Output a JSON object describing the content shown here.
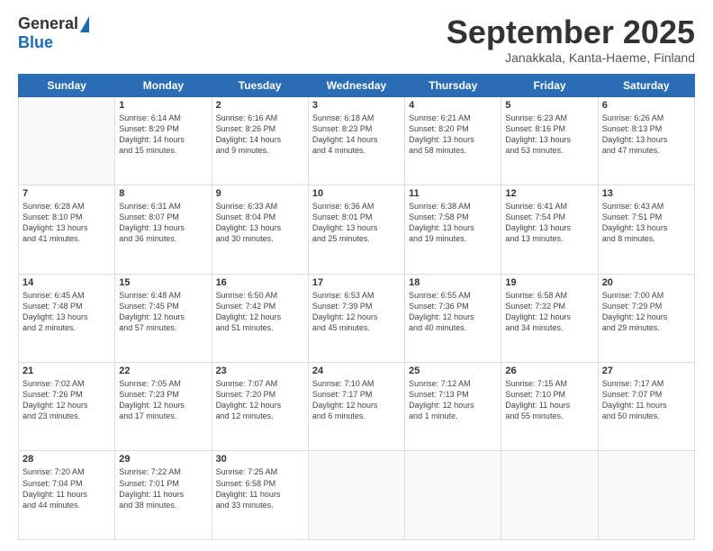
{
  "logo": {
    "general": "General",
    "blue": "Blue"
  },
  "header": {
    "month": "September 2025",
    "location": "Janakkala, Kanta-Haeme, Finland"
  },
  "days": [
    "Sunday",
    "Monday",
    "Tuesday",
    "Wednesday",
    "Thursday",
    "Friday",
    "Saturday"
  ],
  "weeks": [
    [
      {
        "day": "",
        "info": ""
      },
      {
        "day": "1",
        "info": "Sunrise: 6:14 AM\nSunset: 8:29 PM\nDaylight: 14 hours\nand 15 minutes."
      },
      {
        "day": "2",
        "info": "Sunrise: 6:16 AM\nSunset: 8:26 PM\nDaylight: 14 hours\nand 9 minutes."
      },
      {
        "day": "3",
        "info": "Sunrise: 6:18 AM\nSunset: 8:23 PM\nDaylight: 14 hours\nand 4 minutes."
      },
      {
        "day": "4",
        "info": "Sunrise: 6:21 AM\nSunset: 8:20 PM\nDaylight: 13 hours\nand 58 minutes."
      },
      {
        "day": "5",
        "info": "Sunrise: 6:23 AM\nSunset: 8:16 PM\nDaylight: 13 hours\nand 53 minutes."
      },
      {
        "day": "6",
        "info": "Sunrise: 6:26 AM\nSunset: 8:13 PM\nDaylight: 13 hours\nand 47 minutes."
      }
    ],
    [
      {
        "day": "7",
        "info": "Sunrise: 6:28 AM\nSunset: 8:10 PM\nDaylight: 13 hours\nand 41 minutes."
      },
      {
        "day": "8",
        "info": "Sunrise: 6:31 AM\nSunset: 8:07 PM\nDaylight: 13 hours\nand 36 minutes."
      },
      {
        "day": "9",
        "info": "Sunrise: 6:33 AM\nSunset: 8:04 PM\nDaylight: 13 hours\nand 30 minutes."
      },
      {
        "day": "10",
        "info": "Sunrise: 6:36 AM\nSunset: 8:01 PM\nDaylight: 13 hours\nand 25 minutes."
      },
      {
        "day": "11",
        "info": "Sunrise: 6:38 AM\nSunset: 7:58 PM\nDaylight: 13 hours\nand 19 minutes."
      },
      {
        "day": "12",
        "info": "Sunrise: 6:41 AM\nSunset: 7:54 PM\nDaylight: 13 hours\nand 13 minutes."
      },
      {
        "day": "13",
        "info": "Sunrise: 6:43 AM\nSunset: 7:51 PM\nDaylight: 13 hours\nand 8 minutes."
      }
    ],
    [
      {
        "day": "14",
        "info": "Sunrise: 6:45 AM\nSunset: 7:48 PM\nDaylight: 13 hours\nand 2 minutes."
      },
      {
        "day": "15",
        "info": "Sunrise: 6:48 AM\nSunset: 7:45 PM\nDaylight: 12 hours\nand 57 minutes."
      },
      {
        "day": "16",
        "info": "Sunrise: 6:50 AM\nSunset: 7:42 PM\nDaylight: 12 hours\nand 51 minutes."
      },
      {
        "day": "17",
        "info": "Sunrise: 6:53 AM\nSunset: 7:39 PM\nDaylight: 12 hours\nand 45 minutes."
      },
      {
        "day": "18",
        "info": "Sunrise: 6:55 AM\nSunset: 7:36 PM\nDaylight: 12 hours\nand 40 minutes."
      },
      {
        "day": "19",
        "info": "Sunrise: 6:58 AM\nSunset: 7:32 PM\nDaylight: 12 hours\nand 34 minutes."
      },
      {
        "day": "20",
        "info": "Sunrise: 7:00 AM\nSunset: 7:29 PM\nDaylight: 12 hours\nand 29 minutes."
      }
    ],
    [
      {
        "day": "21",
        "info": "Sunrise: 7:02 AM\nSunset: 7:26 PM\nDaylight: 12 hours\nand 23 minutes."
      },
      {
        "day": "22",
        "info": "Sunrise: 7:05 AM\nSunset: 7:23 PM\nDaylight: 12 hours\nand 17 minutes."
      },
      {
        "day": "23",
        "info": "Sunrise: 7:07 AM\nSunset: 7:20 PM\nDaylight: 12 hours\nand 12 minutes."
      },
      {
        "day": "24",
        "info": "Sunrise: 7:10 AM\nSunset: 7:17 PM\nDaylight: 12 hours\nand 6 minutes."
      },
      {
        "day": "25",
        "info": "Sunrise: 7:12 AM\nSunset: 7:13 PM\nDaylight: 12 hours\nand 1 minute."
      },
      {
        "day": "26",
        "info": "Sunrise: 7:15 AM\nSunset: 7:10 PM\nDaylight: 11 hours\nand 55 minutes."
      },
      {
        "day": "27",
        "info": "Sunrise: 7:17 AM\nSunset: 7:07 PM\nDaylight: 11 hours\nand 50 minutes."
      }
    ],
    [
      {
        "day": "28",
        "info": "Sunrise: 7:20 AM\nSunset: 7:04 PM\nDaylight: 11 hours\nand 44 minutes."
      },
      {
        "day": "29",
        "info": "Sunrise: 7:22 AM\nSunset: 7:01 PM\nDaylight: 11 hours\nand 38 minutes."
      },
      {
        "day": "30",
        "info": "Sunrise: 7:25 AM\nSunset: 6:58 PM\nDaylight: 11 hours\nand 33 minutes."
      },
      {
        "day": "",
        "info": ""
      },
      {
        "day": "",
        "info": ""
      },
      {
        "day": "",
        "info": ""
      },
      {
        "day": "",
        "info": ""
      }
    ]
  ]
}
